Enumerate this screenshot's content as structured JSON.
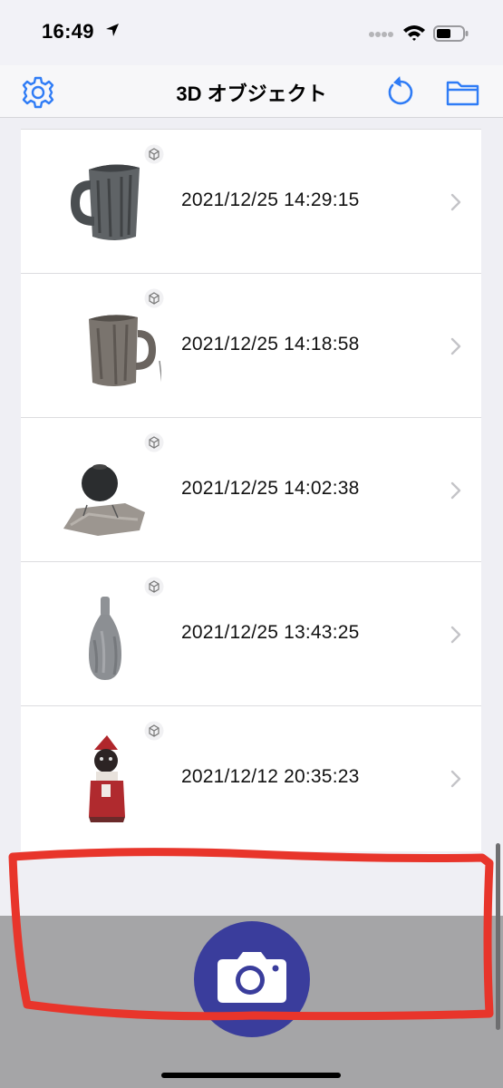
{
  "status_bar": {
    "time": "16:49",
    "icons": [
      "location-arrow-icon",
      "cellular-signal-icon",
      "wifi-icon",
      "battery-icon"
    ]
  },
  "nav": {
    "title": "3D オブジェクト",
    "left_icon": "gear-icon",
    "right_icons": [
      "refresh-icon",
      "folder-icon"
    ],
    "accent_color": "#2f7cf6"
  },
  "objects": [
    {
      "date": "2021/12/25 14:29:15",
      "thumbnail": "mug-dark"
    },
    {
      "date": "2021/12/25 14:18:58",
      "thumbnail": "mug-grey"
    },
    {
      "date": "2021/12/25 14:02:38",
      "thumbnail": "round-pot"
    },
    {
      "date": "2021/12/25 13:43:25",
      "thumbnail": "bottle-vase"
    },
    {
      "date": "2021/12/12 20:35:23",
      "thumbnail": "santa-figure"
    }
  ],
  "bottom": {
    "camera_icon": "camera-icon",
    "camera_button_color": "#3a3d9c",
    "annotation_color": "#e8352b"
  }
}
